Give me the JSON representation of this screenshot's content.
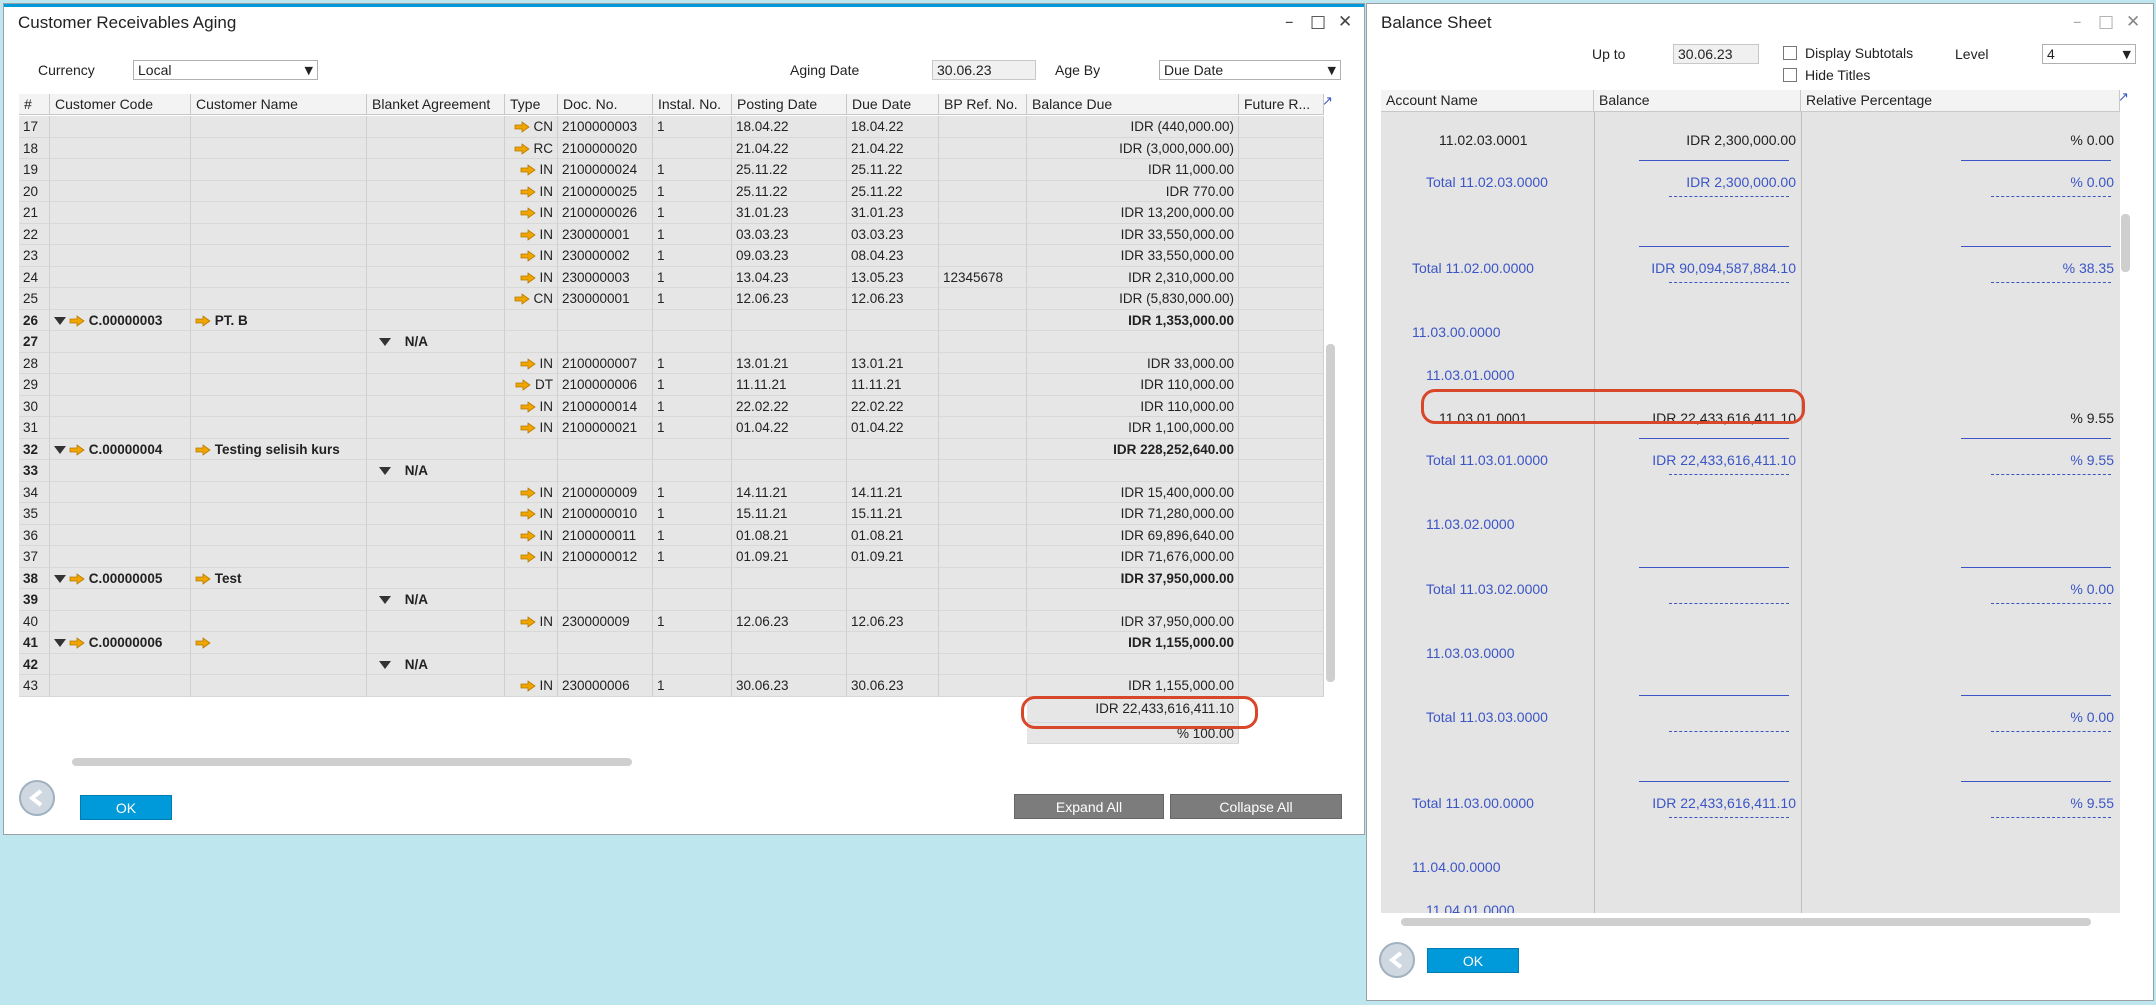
{
  "aging": {
    "title": "Customer Receivables Aging",
    "currency_label": "Currency",
    "currency_value": "Local",
    "aging_date_label": "Aging Date",
    "aging_date_value": "30.06.23",
    "age_by_label": "Age By",
    "age_by_value": "Due Date",
    "columns": [
      "#",
      "Customer Code",
      "Customer Name",
      "Blanket Agreement",
      "Type",
      "Doc. No.",
      "Instal. No.",
      "Posting Date",
      "Due Date",
      "BP Ref. No.",
      "Balance Due",
      "Future R..."
    ],
    "rows": [
      {
        "n": "17",
        "kind": "doc",
        "type": "CN",
        "doc": "2100000003",
        "inst": "1",
        "post": "18.04.22",
        "due": "18.04.22",
        "ref": "",
        "bal": "IDR (440,000.00)"
      },
      {
        "n": "18",
        "kind": "doc",
        "type": "RC",
        "doc": "2100000020",
        "inst": "",
        "post": "21.04.22",
        "due": "21.04.22",
        "ref": "",
        "bal": "IDR (3,000,000.00)"
      },
      {
        "n": "19",
        "kind": "doc",
        "type": "IN",
        "doc": "2100000024",
        "inst": "1",
        "post": "25.11.22",
        "due": "25.11.22",
        "ref": "",
        "bal": "IDR  11,000.00"
      },
      {
        "n": "20",
        "kind": "doc",
        "type": "IN",
        "doc": "2100000025",
        "inst": "1",
        "post": "25.11.22",
        "due": "25.11.22",
        "ref": "",
        "bal": "IDR  770.00"
      },
      {
        "n": "21",
        "kind": "doc",
        "type": "IN",
        "doc": "2100000026",
        "inst": "1",
        "post": "31.01.23",
        "due": "31.01.23",
        "ref": "",
        "bal": "IDR  13,200,000.00"
      },
      {
        "n": "22",
        "kind": "doc",
        "type": "IN",
        "doc": "230000001",
        "inst": "1",
        "post": "03.03.23",
        "due": "03.03.23",
        "ref": "",
        "bal": "IDR  33,550,000.00"
      },
      {
        "n": "23",
        "kind": "doc",
        "type": "IN",
        "doc": "230000002",
        "inst": "1",
        "post": "09.03.23",
        "due": "08.04.23",
        "ref": "",
        "bal": "IDR  33,550,000.00"
      },
      {
        "n": "24",
        "kind": "doc",
        "type": "IN",
        "doc": "230000003",
        "inst": "1",
        "post": "13.04.23",
        "due": "13.05.23",
        "ref": "12345678",
        "bal": "IDR  2,310,000.00"
      },
      {
        "n": "25",
        "kind": "doc",
        "type": "CN",
        "doc": "230000001",
        "inst": "1",
        "post": "12.06.23",
        "due": "12.06.23",
        "ref": "",
        "bal": "IDR (5,830,000.00)"
      },
      {
        "n": "26",
        "kind": "cust",
        "code": "C.00000003",
        "name": "PT. B",
        "bal": "IDR  1,353,000.00"
      },
      {
        "n": "27",
        "kind": "na",
        "na": "N/A"
      },
      {
        "n": "28",
        "kind": "doc",
        "type": "IN",
        "doc": "2100000007",
        "inst": "1",
        "post": "13.01.21",
        "due": "13.01.21",
        "ref": "",
        "bal": "IDR  33,000.00"
      },
      {
        "n": "29",
        "kind": "doc",
        "type": "DT",
        "doc": "2100000006",
        "inst": "1",
        "post": "11.11.21",
        "due": "11.11.21",
        "ref": "",
        "bal": "IDR  110,000.00"
      },
      {
        "n": "30",
        "kind": "doc",
        "type": "IN",
        "doc": "2100000014",
        "inst": "1",
        "post": "22.02.22",
        "due": "22.02.22",
        "ref": "",
        "bal": "IDR  110,000.00"
      },
      {
        "n": "31",
        "kind": "doc",
        "type": "IN",
        "doc": "2100000021",
        "inst": "1",
        "post": "01.04.22",
        "due": "01.04.22",
        "ref": "",
        "bal": "IDR  1,100,000.00"
      },
      {
        "n": "32",
        "kind": "cust",
        "code": "C.00000004",
        "name": "Testing selisih kurs",
        "bal": "IDR  228,252,640.00"
      },
      {
        "n": "33",
        "kind": "na",
        "na": "N/A"
      },
      {
        "n": "34",
        "kind": "doc",
        "type": "IN",
        "doc": "2100000009",
        "inst": "1",
        "post": "14.11.21",
        "due": "14.11.21",
        "ref": "",
        "bal": "IDR  15,400,000.00"
      },
      {
        "n": "35",
        "kind": "doc",
        "type": "IN",
        "doc": "2100000010",
        "inst": "1",
        "post": "15.11.21",
        "due": "15.11.21",
        "ref": "",
        "bal": "IDR  71,280,000.00"
      },
      {
        "n": "36",
        "kind": "doc",
        "type": "IN",
        "doc": "2100000011",
        "inst": "1",
        "post": "01.08.21",
        "due": "01.08.21",
        "ref": "",
        "bal": "IDR  69,896,640.00"
      },
      {
        "n": "37",
        "kind": "doc",
        "type": "IN",
        "doc": "2100000012",
        "inst": "1",
        "post": "01.09.21",
        "due": "01.09.21",
        "ref": "",
        "bal": "IDR  71,676,000.00"
      },
      {
        "n": "38",
        "kind": "cust",
        "code": "C.00000005",
        "name": "Test",
        "bal": "IDR  37,950,000.00"
      },
      {
        "n": "39",
        "kind": "na",
        "na": "N/A"
      },
      {
        "n": "40",
        "kind": "doc",
        "type": "IN",
        "doc": "230000009",
        "inst": "1",
        "post": "12.06.23",
        "due": "12.06.23",
        "ref": "",
        "bal": "IDR  37,950,000.00"
      },
      {
        "n": "41",
        "kind": "cust",
        "code": "C.00000006",
        "name": "",
        "bal": "IDR  1,155,000.00"
      },
      {
        "n": "42",
        "kind": "na",
        "na": "N/A"
      },
      {
        "n": "43",
        "kind": "doc",
        "type": "IN",
        "doc": "230000006",
        "inst": "1",
        "post": "30.06.23",
        "due": "30.06.23",
        "ref": "",
        "bal": "IDR  1,155,000.00"
      }
    ],
    "total_balance": "IDR  22,433,616,411.10",
    "total_percent": "% 100.00",
    "ok_label": "OK",
    "expand_label": "Expand All",
    "collapse_label": "Collapse All"
  },
  "balance": {
    "title": "Balance Sheet",
    "up_to_label": "Up to",
    "up_to_value": "30.06.23",
    "display_subtotals_label": "Display Subtotals",
    "hide_titles_label": "Hide Titles",
    "level_label": "Level",
    "level_value": "4",
    "columns": [
      "Account Name",
      "Balance",
      "Relative Percentage"
    ],
    "rows": [
      {
        "name": "11.02.03.0001",
        "style": "plain",
        "bal": "IDR  2,300,000.00",
        "pct": "% 0.00"
      },
      {
        "name": "Total 11.02.03.0000",
        "style": "total",
        "bal": "IDR  2,300,000.00",
        "pct": "% 0.00"
      },
      {
        "name": "Total 11.02.00.0000",
        "style": "total",
        "bal": "IDR  90,094,587,884.10",
        "pct": "% 38.35"
      },
      {
        "name": "11.03.00.0000",
        "style": "title",
        "bal": "",
        "pct": ""
      },
      {
        "name": "11.03.01.0000",
        "style": "title",
        "bal": "",
        "pct": ""
      },
      {
        "name": "11.03.01.0001",
        "style": "plain",
        "bal": "IDR  22,433,616,411.10",
        "pct": "% 9.55"
      },
      {
        "name": "Total 11.03.01.0000",
        "style": "total",
        "bal": "IDR  22,433,616,411.10",
        "pct": "% 9.55"
      },
      {
        "name": "11.03.02.0000",
        "style": "title",
        "bal": "",
        "pct": ""
      },
      {
        "name": "Total 11.03.02.0000",
        "style": "total",
        "bal": "",
        "pct": "% 0.00"
      },
      {
        "name": "11.03.03.0000",
        "style": "title",
        "bal": "",
        "pct": ""
      },
      {
        "name": "Total 11.03.03.0000",
        "style": "total",
        "bal": "",
        "pct": "% 0.00"
      },
      {
        "name": "Total 11.03.00.0000",
        "style": "total",
        "bal": "IDR  22,433,616,411.10",
        "pct": "% 9.55"
      },
      {
        "name": "11.04.00.0000",
        "style": "title",
        "bal": "",
        "pct": ""
      },
      {
        "name": "11.04.01.0000",
        "style": "title",
        "bal": "",
        "pct": ""
      }
    ],
    "ok_label": "OK"
  },
  "colors": {
    "accent": "#0099d9",
    "highlight": "#d9472b",
    "link_blue": "#3b55c6",
    "arrow": "#f0a500"
  },
  "icons": [
    "link-arrow-icon",
    "expand-triangle-icon",
    "back-icon",
    "minimize-icon",
    "maximize-icon",
    "close-icon",
    "dropdown-caret-icon"
  ]
}
